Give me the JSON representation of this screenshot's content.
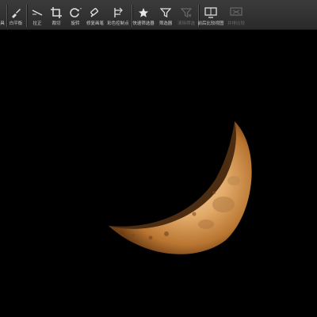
{
  "toolbar": {
    "items": [
      {
        "label": "具",
        "icon": "tool-partial-icon",
        "enabled": true
      },
      {
        "label": "白平衡",
        "icon": "brush-icon",
        "enabled": true
      },
      {
        "label": "拉正",
        "icon": "straighten-icon",
        "enabled": true
      },
      {
        "label": "裁切",
        "icon": "crop-icon",
        "enabled": true
      },
      {
        "label": "旋转",
        "icon": "rotate-icon",
        "enabled": true
      },
      {
        "label": "修复画笔",
        "icon": "healing-brush-icon",
        "enabled": true
      },
      {
        "label": "彩色控制点",
        "icon": "color-control-point-icon",
        "enabled": true
      },
      {
        "label": "快速筛选器",
        "icon": "star-icon",
        "enabled": true
      },
      {
        "label": "筛选器",
        "icon": "filter-icon",
        "enabled": true
      },
      {
        "label": "清除筛选",
        "icon": "clear-filter-icon",
        "enabled": false
      },
      {
        "label": "前后比较视图",
        "icon": "compare-view-icon",
        "enabled": true
      },
      {
        "label": "并排比较",
        "icon": "side-by-side-icon",
        "enabled": false
      }
    ]
  },
  "colors": {
    "toolbar_bg": "#333333",
    "canvas_bg": "#000000",
    "moon_light": "#f3c98e",
    "moon_mid": "#d39a56",
    "moon_dark": "#7a4a1e"
  }
}
